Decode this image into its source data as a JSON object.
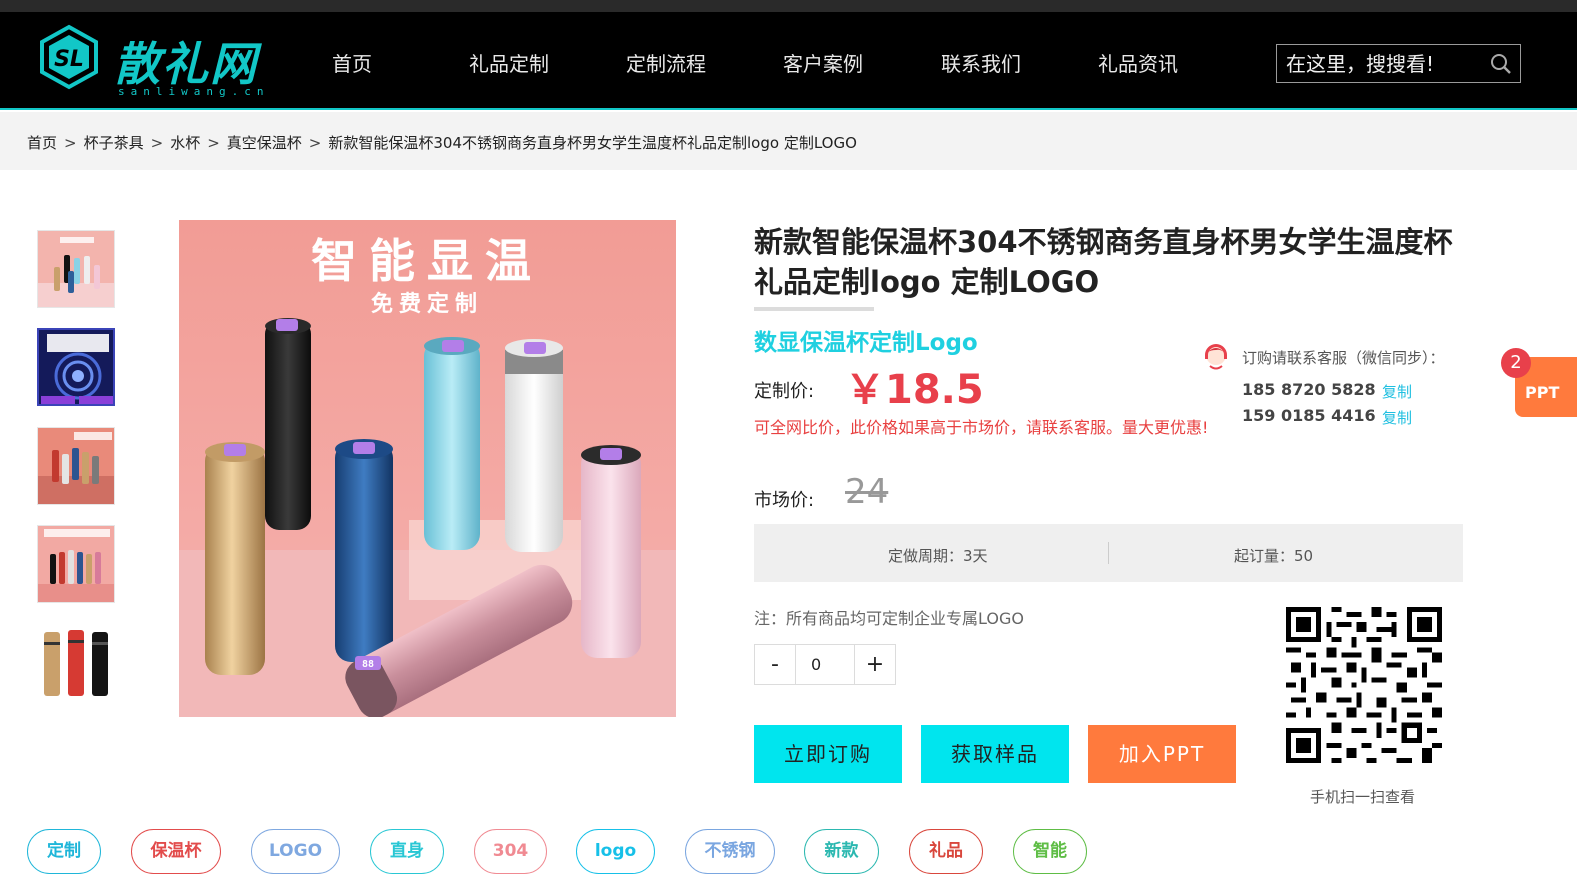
{
  "brand": {
    "logo_mark": "SL",
    "logo_text": "散礼网",
    "logo_subtext": "sanliwang.cn",
    "accent_color": "#12c7c7"
  },
  "nav": {
    "items": [
      "首页",
      "礼品定制",
      "定制流程",
      "客户案例",
      "联系我们",
      "礼品资讯"
    ]
  },
  "search": {
    "placeholder": "在这里，搜搜看!",
    "icon": "search-icon"
  },
  "breadcrumb": {
    "items": [
      "首页",
      "杯子茶具",
      "水杯",
      "真空保温杯",
      "新款智能保温杯304不锈钢商务直身杯男女学生温度杯礼品定制logo 定制LOGO"
    ],
    "separator": ">"
  },
  "gallery": {
    "main_heading": "智能显温",
    "main_subheading": "免费定制",
    "bottle_display": "88",
    "thumbnail_count": 5,
    "active_thumbnail": 2
  },
  "product": {
    "title": "新款智能保温杯304不锈钢商务直身杯男女学生温度杯礼品定制logo 定制LOGO",
    "subtitle": "数显保温杯定制Logo",
    "price_label": "定制价:",
    "price": "￥18.5",
    "price_note": "可全网比价，此价格如果高于市场价，请联系客服。量大更优惠!",
    "market_price_label": "市场价:",
    "market_price": "24",
    "price_color": "#e8404b"
  },
  "contact": {
    "label": "订购请联系客服（微信同步）：",
    "phones": [
      "185 8720 5828",
      "159 0185 4416"
    ],
    "copy_label": "复制"
  },
  "ppt": {
    "label": "PPT",
    "count": "2"
  },
  "specs": {
    "lead_time": "定做周期：3天",
    "min_order": "起订量：50"
  },
  "custom_note": "注：所有商品均可定制企业专属LOGO",
  "quantity": {
    "minus": "-",
    "value": "0",
    "plus": "+"
  },
  "actions": {
    "buy_now": "立即订购",
    "get_sample": "获取样品",
    "add_ppt": "加入PPT",
    "buy_color": "#00e5ee",
    "sample_color": "#00e5ee",
    "ppt_color": "#ff7a3d"
  },
  "qr": {
    "caption": "手机扫一扫查看"
  },
  "tags": [
    {
      "label": "定制",
      "color": "#1fb6d9"
    },
    {
      "label": "保温杯",
      "color": "#e24c4c"
    },
    {
      "label": "LOGO",
      "color": "#7fa8e0"
    },
    {
      "label": "直身",
      "color": "#29c7d4"
    },
    {
      "label": "304",
      "color": "#f08a92"
    },
    {
      "label": "logo",
      "color": "#16c0e8"
    },
    {
      "label": "不锈钢",
      "color": "#7aa6e0"
    },
    {
      "label": "新款",
      "color": "#2bb8b0"
    },
    {
      "label": "礼品",
      "color": "#d9473d"
    },
    {
      "label": "智能",
      "color": "#5ebd45"
    }
  ]
}
